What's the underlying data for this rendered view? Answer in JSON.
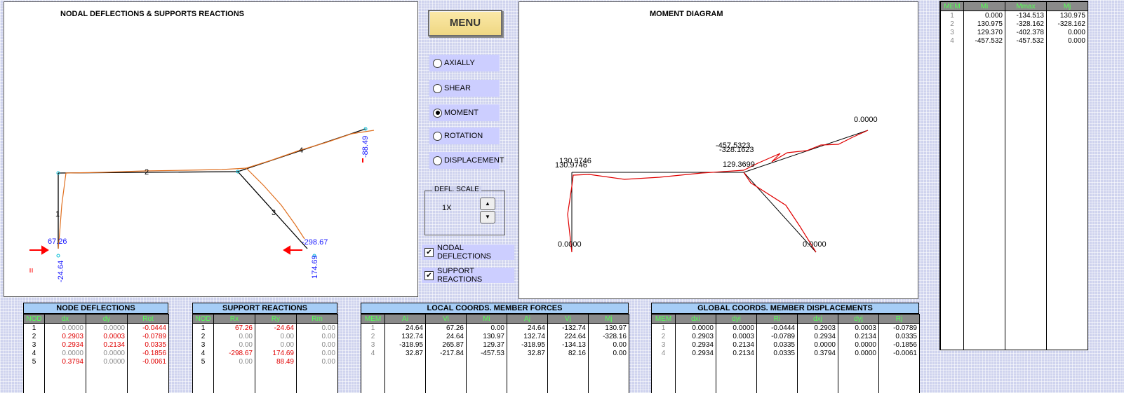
{
  "left_panel": {
    "title": "NODAL DEFLECTIONS & SUPPORTS REACTIONS",
    "member_labels": [
      "1",
      "2",
      "3",
      "4"
    ],
    "reaction_labels": [
      "67.26",
      "-24.64",
      "-298.67",
      "174.69",
      "-88.49"
    ]
  },
  "right_panel": {
    "title": "MOMENT DIAGRAM",
    "value_labels": [
      "0.0000",
      "130.9746",
      "130.9746",
      "-457.5323",
      "-328.1623",
      "129.3699",
      "0.0000",
      "0.0000"
    ]
  },
  "menu": {
    "menu_label": "MENU",
    "options": [
      {
        "label": "AXIALLY",
        "selected": false
      },
      {
        "label": "SHEAR",
        "selected": false
      },
      {
        "label": "MOMENT",
        "selected": true
      },
      {
        "label": "ROTATION",
        "selected": false
      },
      {
        "label": "DISPLACEMENT",
        "selected": false
      }
    ],
    "defl_scale_label": "DEFL. SCALE",
    "defl_scale_value": "1X",
    "checkboxes": [
      {
        "label": "NODAL DEFLECTIONS",
        "checked": true
      },
      {
        "label": "SUPPORT REACTIONS",
        "checked": true
      }
    ]
  },
  "moment_table": {
    "headers": [
      "MEM",
      "Mi",
      "Mmax",
      "Mj"
    ],
    "rows": [
      [
        "1",
        "0.000",
        "-134.513",
        "130.975"
      ],
      [
        "2",
        "130.975",
        "-328.162",
        "-328.162"
      ],
      [
        "3",
        "129.370",
        "-402.378",
        "0.000"
      ],
      [
        "4",
        "-457.532",
        "-457.532",
        "0.000"
      ]
    ]
  },
  "node_deflections": {
    "title": "NODE DEFLECTIONS",
    "headers": [
      "NOD",
      "dx",
      "dy",
      "Rot"
    ],
    "rows": [
      [
        "1",
        "0.0000",
        "0.0000",
        "-0.0444"
      ],
      [
        "2",
        "0.2903",
        "0.0003",
        "-0.0789"
      ],
      [
        "3",
        "0.2934",
        "0.2134",
        "0.0335"
      ],
      [
        "4",
        "0.0000",
        "0.0000",
        "-0.1856"
      ],
      [
        "5",
        "0.3794",
        "0.0000",
        "-0.0061"
      ]
    ]
  },
  "support_reactions": {
    "title": "SUPPORT REACTIONS",
    "headers": [
      "NOD",
      "Rx",
      "Ry",
      "Rm"
    ],
    "rows": [
      [
        "1",
        "67.26",
        "-24.64",
        "0.00"
      ],
      [
        "2",
        "0.00",
        "0.00",
        "0.00"
      ],
      [
        "3",
        "0.00",
        "0.00",
        "0.00"
      ],
      [
        "4",
        "-298.67",
        "174.69",
        "0.00"
      ],
      [
        "5",
        "0.00",
        "88.49",
        "0.00"
      ]
    ]
  },
  "member_forces": {
    "title": "LOCAL COORDS. MEMBER FORCES",
    "headers": [
      "MEM",
      "Ai",
      "Vi",
      "Mi",
      "Aj",
      "Vj",
      "Mj"
    ],
    "rows": [
      [
        "1",
        "24.64",
        "67.26",
        "0.00",
        "24.64",
        "-132.74",
        "130.97"
      ],
      [
        "2",
        "132.74",
        "24.64",
        "130.97",
        "132.74",
        "224.64",
        "-328.16"
      ],
      [
        "3",
        "-318.95",
        "265.87",
        "129.37",
        "-318.95",
        "-134.13",
        "0.00"
      ],
      [
        "4",
        "32.87",
        "-217.84",
        "-457.53",
        "32.87",
        "82.16",
        "0.00"
      ]
    ]
  },
  "member_displacements": {
    "title": "GLOBAL COORDS. MEMBER DISPLACEMENTS",
    "headers": [
      "MEM",
      "dxi",
      "dyi",
      "Ri",
      "dxj",
      "dyj",
      "Rj"
    ],
    "rows": [
      [
        "1",
        "0.0000",
        "0.0000",
        "-0.0444",
        "0.2903",
        "0.0003",
        "-0.0789"
      ],
      [
        "2",
        "0.2903",
        "0.0003",
        "-0.0789",
        "0.2934",
        "0.2134",
        "0.0335"
      ],
      [
        "3",
        "0.2934",
        "0.2134",
        "0.0335",
        "0.0000",
        "0.0000",
        "-0.1856"
      ],
      [
        "4",
        "0.2934",
        "0.2134",
        "0.0335",
        "0.3794",
        "0.0000",
        "-0.0061"
      ]
    ]
  },
  "colors": {
    "structure": "#000000",
    "deflected": "#e07020",
    "moment": "#e00000",
    "reaction_label": "#1a1aff",
    "arrow": "#ff0000",
    "table_title_bg": "#a6cdf6",
    "header_bg": "#8a8a8a",
    "header_text": "#55ff55"
  }
}
